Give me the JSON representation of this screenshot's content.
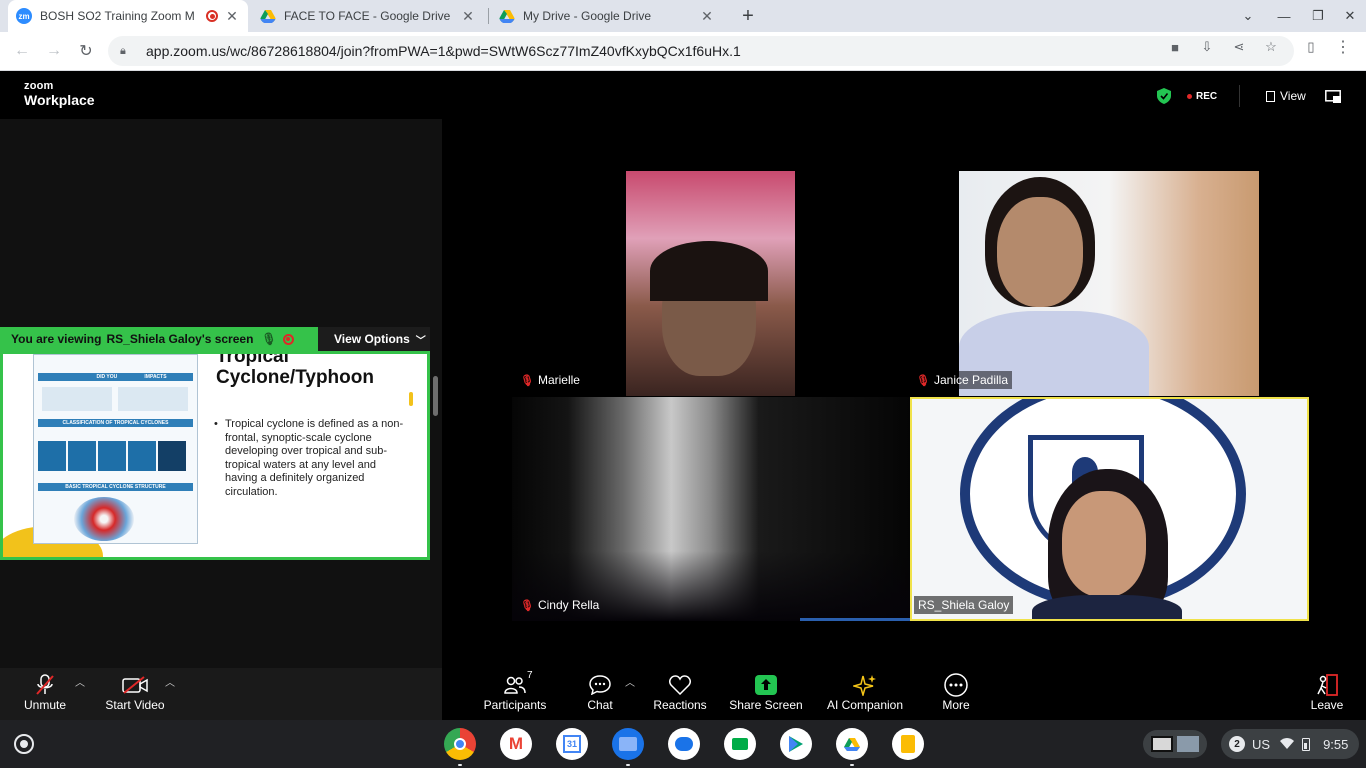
{
  "browser": {
    "tabs": [
      {
        "title": "BOSH SO2 Training Zoom M",
        "favicon": "zoom-icon",
        "recording": true
      },
      {
        "title": "FACE TO FACE - Google Drive",
        "favicon": "google-drive-icon"
      },
      {
        "title": "My Drive - Google Drive",
        "favicon": "google-drive-icon"
      }
    ],
    "url": "app.zoom.us/wc/86728618804/join?fromPWA=1&pwd=SWtW6Scz77ImZ40vfKxybQCx1f6uHx.1"
  },
  "zoom": {
    "brand_line1": "zoom",
    "brand_line2": "Workplace",
    "rec_label": "REC",
    "view_label": "View",
    "share_banner": {
      "prefix": "You are viewing",
      "name": "RS_Shiela Galoy's screen"
    },
    "view_options": "View Options",
    "slide": {
      "heading_line1": "Tropical",
      "heading_line2": "Cyclone/Typhoon",
      "body": "Tropical cyclone is defined as a non-frontal, synoptic-scale cyclone developing over tropical and sub-tropical waters at any level and having a definitely organized circulation.",
      "poster_labels": [
        "DID YOU KNOW",
        "IMPACTS",
        "CLASSIFICATION OF TROPICAL CYCLONES",
        "BASIC TROPICAL CYCLONE STRUCTURE"
      ]
    },
    "participants": [
      {
        "name": "Marielle",
        "muted": true
      },
      {
        "name": "Janice Padilla",
        "muted": true
      },
      {
        "name": "Cindy Rella",
        "muted": true
      },
      {
        "name": "RS_Shiela Galoy",
        "muted": false
      }
    ],
    "footer": {
      "unmute": "Unmute",
      "start_video": "Start Video",
      "participants": "Participants",
      "participants_count": "7",
      "chat": "Chat",
      "reactions": "Reactions",
      "share_screen": "Share Screen",
      "ai_companion": "AI Companion",
      "more": "More",
      "leave": "Leave"
    }
  },
  "shelf": {
    "apps": [
      "chrome-icon",
      "gmail-icon",
      "calendar-icon",
      "files-icon",
      "chat-icon",
      "meet-icon",
      "play-store-icon",
      "drive-icon",
      "keep-icon"
    ],
    "calendar_day": "31",
    "notification_count": "2",
    "keyboard_layout": "US",
    "time": "9:55"
  },
  "colors": {
    "accent_green": "#35c24a",
    "active_speaker": "#f0e24a",
    "rec_red": "#e02828"
  }
}
